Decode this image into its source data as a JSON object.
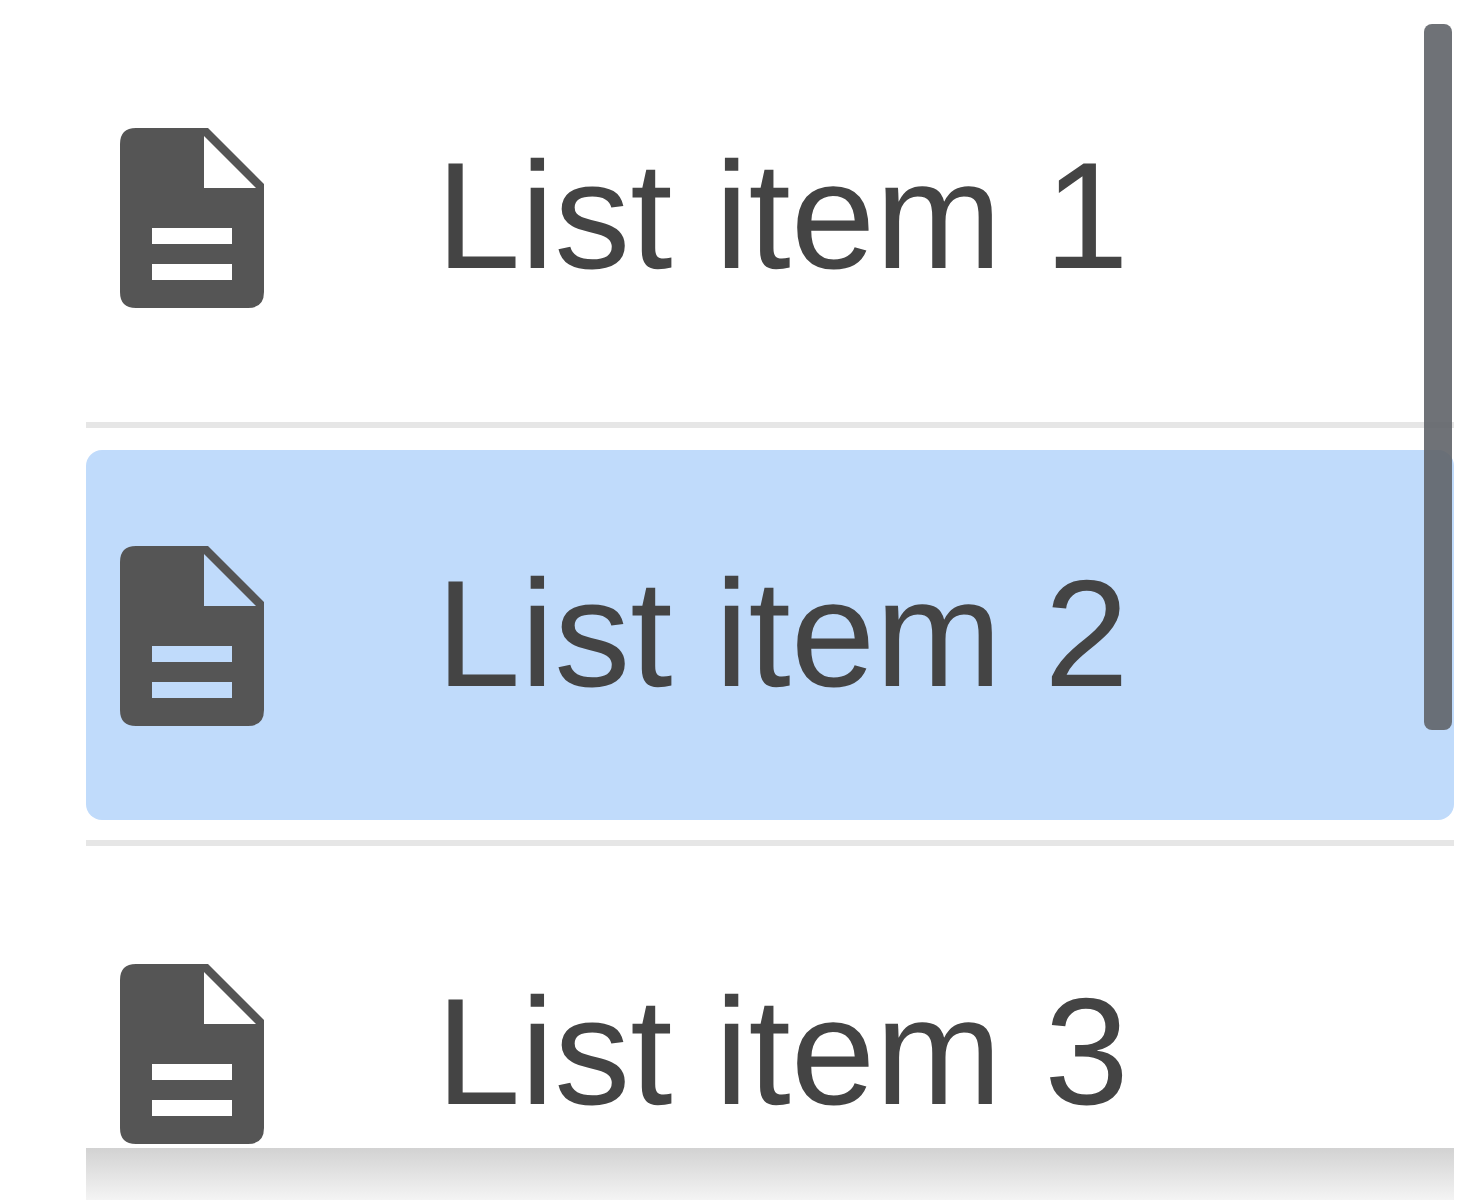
{
  "list": {
    "items": [
      {
        "label": "List item 1",
        "selected": false
      },
      {
        "label": "List item 2",
        "selected": true
      },
      {
        "label": "List item 3",
        "selected": false
      }
    ]
  }
}
